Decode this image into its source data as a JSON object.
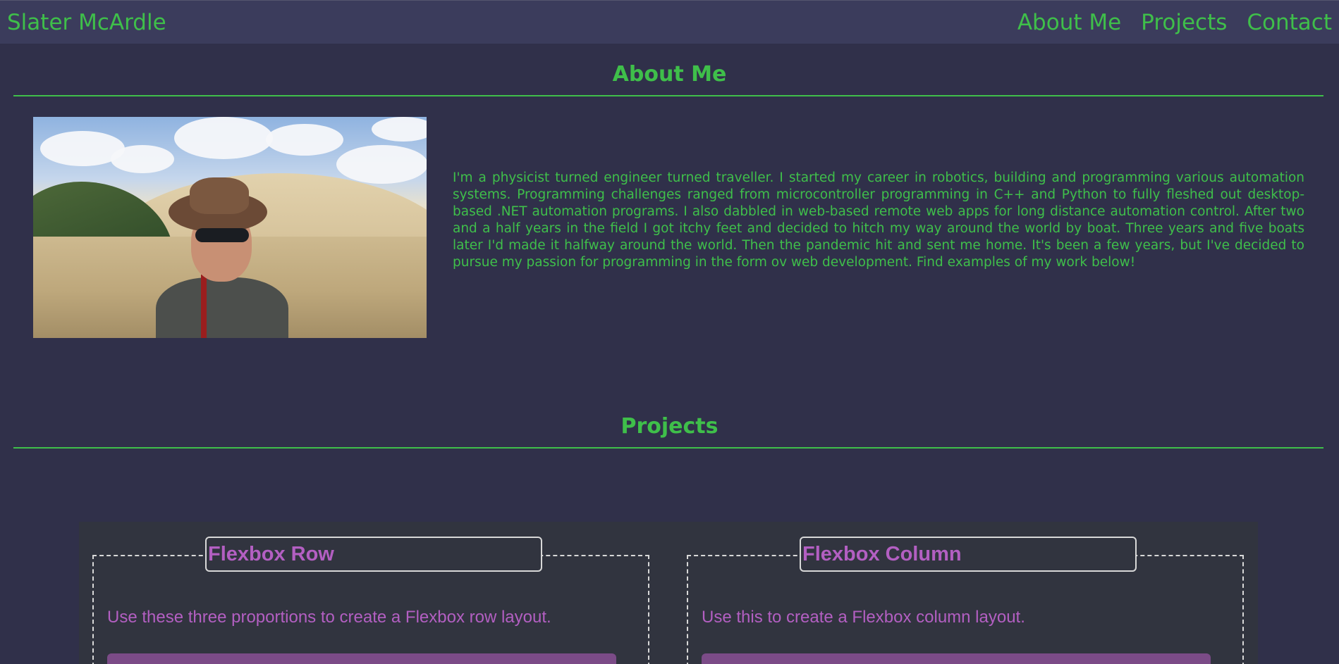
{
  "nav": {
    "brand": "Slater McArdle",
    "links": [
      "About Me",
      "Projects",
      "Contact"
    ]
  },
  "about": {
    "title": "About Me",
    "text": "I'm a physicist turned engineer turned traveller. I started my career in robotics, building and programming various automation systems. Programming challenges ranged from microcontroller programming in C++ and Python to fully fleshed out desktop-based .NET automation programs. I also dabbled in web-based remote web apps for long distance automation control. After two and a half years in the field I got itchy feet and decided to hitch my way around the world by boat. Three years and five boats later I'd made it halfway around the world. Then the pandemic hit and sent me home. It's been a few years, but I've decided to pursue my passion for programming in the form ov web development. Find examples of my work below!"
  },
  "projects": {
    "title": "Projects",
    "cards": [
      {
        "title": "Flexbox Row",
        "description": "Use these three proportions to create a Flexbox row layout."
      },
      {
        "title": "Flexbox Column",
        "description": "Use this to create a Flexbox column layout."
      }
    ]
  },
  "colors": {
    "background": "#30304a",
    "navbar": "#3b3c5c",
    "accent_green": "#3fbf4a",
    "panel": "#31343f",
    "card_purple": "#b35fc2"
  }
}
